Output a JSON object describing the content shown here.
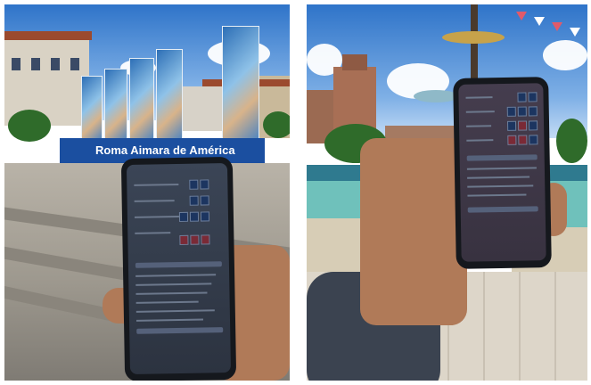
{
  "figure": {
    "left_photo": {
      "sign_text": "Roma Aimara de América"
    },
    "right_photo": {}
  }
}
